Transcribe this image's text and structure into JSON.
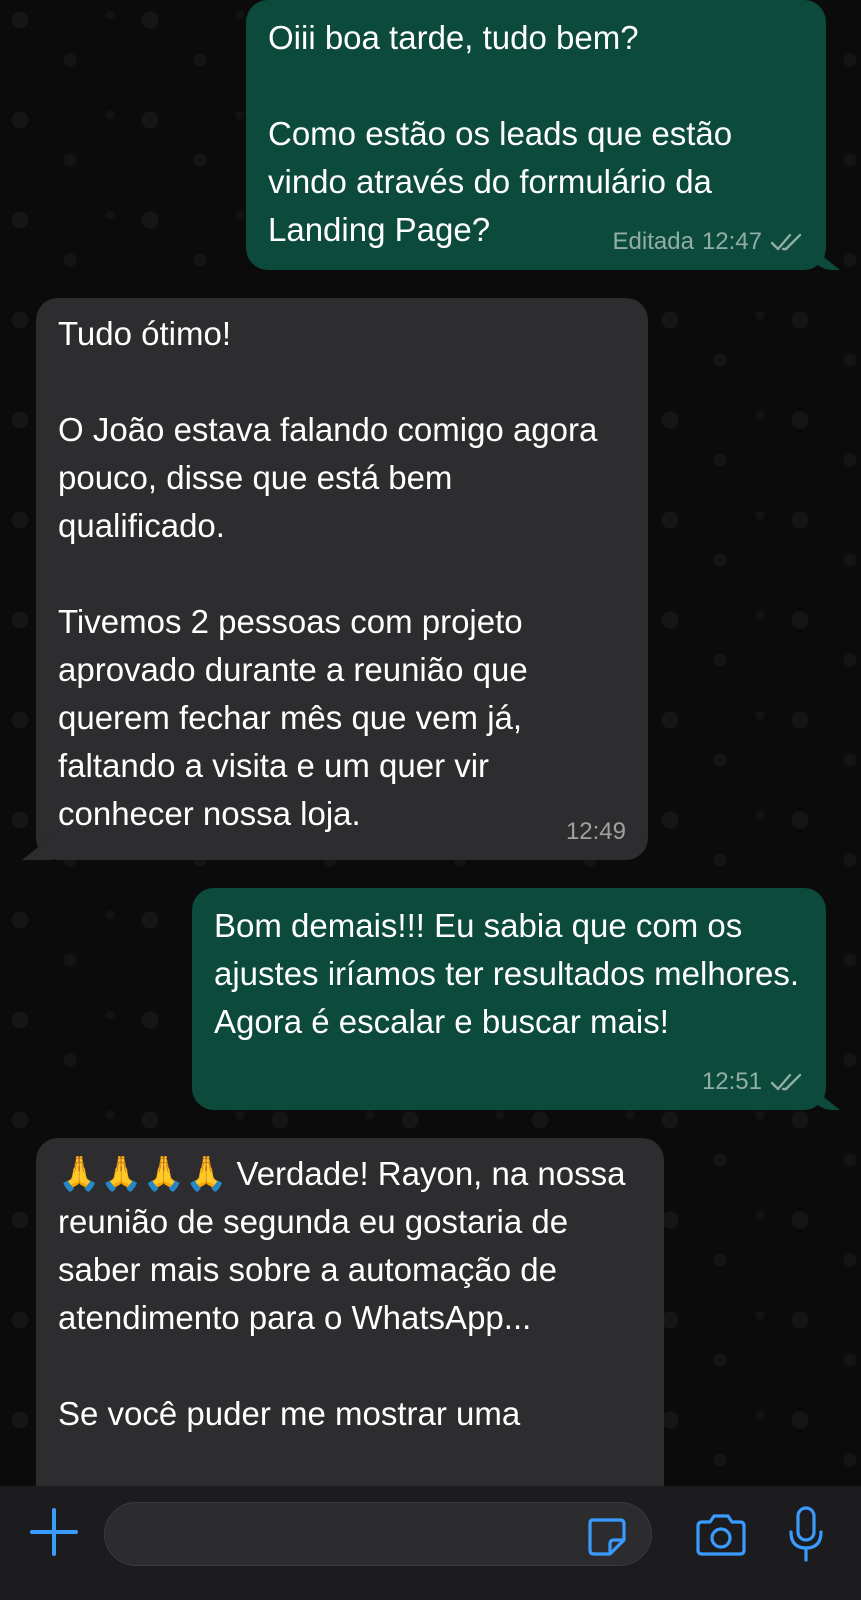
{
  "messages": [
    {
      "direction": "outgoing",
      "text": "Oiii boa tarde, tudo bem?\n\nComo estão os leads que estão vindo através do formulário da Landing Page?",
      "edited_label": "Editada",
      "time": "12:47",
      "status_icon": "double-check-icon"
    },
    {
      "direction": "incoming",
      "text": "Tudo ótimo!\n\nO João estava falando comigo agora pouco, disse que está bem qualificado.\n\nTivemos 2 pessoas com projeto aprovado durante a reunião que querem fechar mês que vem já, faltando a visita e um quer vir conhecer nossa loja.",
      "time": "12:49"
    },
    {
      "direction": "outgoing",
      "text": "Bom demais!!! Eu sabia que com os ajustes iríamos ter resultados melhores. Agora é escalar e buscar mais!",
      "time": "12:51",
      "status_icon": "double-check-icon"
    },
    {
      "direction": "incoming",
      "emoji": "🙏🙏🙏🙏",
      "text": " Verdade! Rayon, na nossa reunião de segunda eu gostaria de saber mais sobre a automação de atendimento para o WhatsApp...\n\nSe você puder me mostrar uma"
    }
  ],
  "input_bar": {
    "placeholder": "",
    "icons": [
      "plus-icon",
      "sticker-icon",
      "camera-icon",
      "microphone-icon"
    ],
    "accent_color": "#3a9bff"
  },
  "colors": {
    "outgoing_bubble": "#0c4a3c",
    "incoming_bubble": "#2d2d2f",
    "background": "#0b0b0b"
  }
}
